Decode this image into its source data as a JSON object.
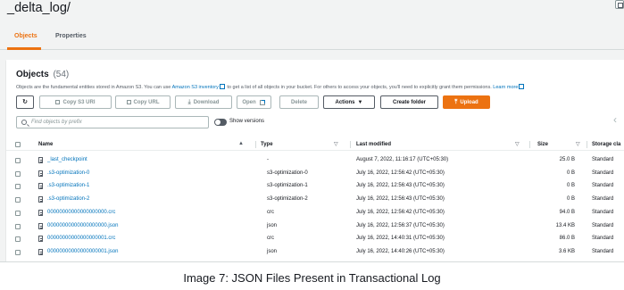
{
  "path": {
    "title": "_delta_log/"
  },
  "tabs": [
    {
      "label": "Objects",
      "active": true
    },
    {
      "label": "Properties",
      "active": false
    }
  ],
  "objects": {
    "title": "Objects",
    "count": "(54)",
    "description_pre": "Objects are the fundamental entities stored in Amazon S3. You can use ",
    "description_link1": "Amazon S3 inventory",
    "description_mid": " to get a list of all objects in your bucket. For others to access your objects, you'll need to explicitly grant them permissions. ",
    "description_link2": "Learn more"
  },
  "toolbar": {
    "refresh_icon": "refresh-icon",
    "copy_uri": "Copy S3 URI",
    "copy_url": "Copy URL",
    "download": "Download",
    "open": "Open",
    "delete": "Delete",
    "actions": "Actions",
    "create_folder": "Create folder",
    "upload": "Upload"
  },
  "search": {
    "placeholder": "Find objects by prefix"
  },
  "show_versions": {
    "label": "Show versions",
    "on": false
  },
  "table": {
    "columns": [
      "Name",
      "Type",
      "Last modified",
      "Size",
      "Storage cla"
    ],
    "rows": [
      {
        "name": "_last_checkpoint",
        "type": "-",
        "modified": "August 7, 2022, 11:16:17 (UTC+05:30)",
        "size": "25.0 B",
        "storage": "Standard"
      },
      {
        "name": ".s3-optimization-0",
        "type": "s3-optimization-0",
        "modified": "July 16, 2022, 12:56:42 (UTC+05:30)",
        "size": "0 B",
        "storage": "Standard"
      },
      {
        "name": ".s3-optimization-1",
        "type": "s3-optimization-1",
        "modified": "July 16, 2022, 12:56:43 (UTC+05:30)",
        "size": "0 B",
        "storage": "Standard"
      },
      {
        "name": ".s3-optimization-2",
        "type": "s3-optimization-2",
        "modified": "July 16, 2022, 12:56:43 (UTC+05:30)",
        "size": "0 B",
        "storage": "Standard"
      },
      {
        "name": "00000000000000000000.crc",
        "type": "crc",
        "modified": "July 16, 2022, 12:56:42 (UTC+05:30)",
        "size": "94.0 B",
        "storage": "Standard"
      },
      {
        "name": "00000000000000000000.json",
        "type": "json",
        "modified": "July 16, 2022, 12:56:37 (UTC+05:30)",
        "size": "13.4 KB",
        "storage": "Standard"
      },
      {
        "name": "00000000000000000001.crc",
        "type": "crc",
        "modified": "July 16, 2022, 14:40:31 (UTC+05:30)",
        "size": "86.0 B",
        "storage": "Standard"
      },
      {
        "name": "00000000000000000001.json",
        "type": "json",
        "modified": "July 16, 2022, 14:40:26 (UTC+05:30)",
        "size": "3.6 KB",
        "storage": "Standard"
      }
    ]
  },
  "caption": "Image 7: JSON Files Present in Transactional Log",
  "colors": {
    "accent": "#ec7211",
    "link": "#0073bb",
    "background": "#f2f3f3"
  }
}
